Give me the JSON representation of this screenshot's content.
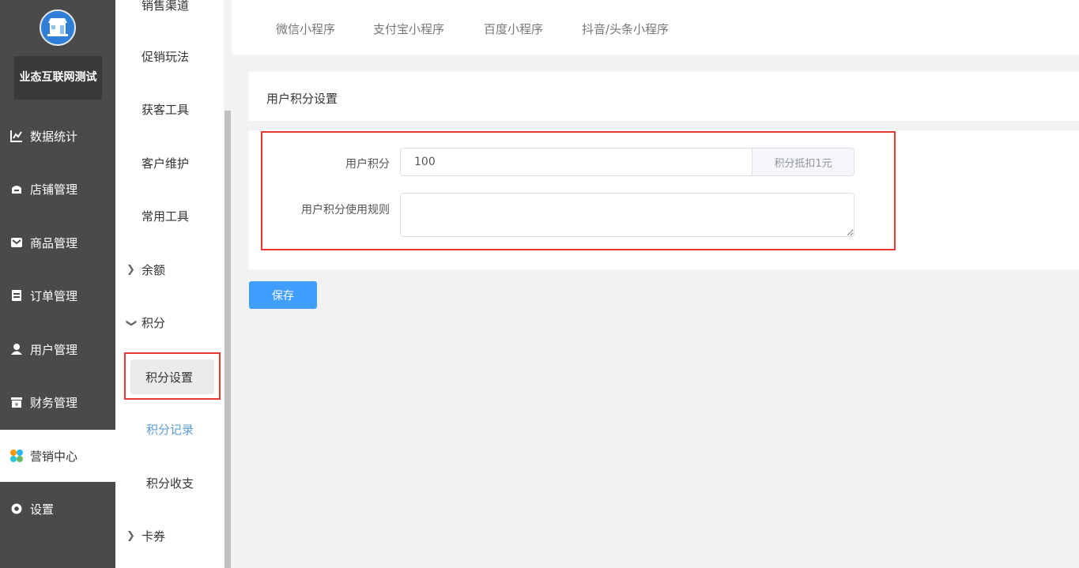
{
  "store": {
    "name": "业态互联网测试"
  },
  "nav": [
    {
      "label": "数据统计",
      "icon": "line-chart-icon"
    },
    {
      "label": "店铺管理",
      "icon": "store-icon"
    },
    {
      "label": "商品管理",
      "icon": "goods-icon"
    },
    {
      "label": "订单管理",
      "icon": "order-icon"
    },
    {
      "label": "用户管理",
      "icon": "user-icon"
    },
    {
      "label": "财务管理",
      "icon": "finance-icon"
    },
    {
      "label": "营销中心",
      "icon": "marketing-icon",
      "active": true
    },
    {
      "label": "设置",
      "icon": "settings-icon"
    }
  ],
  "submenu": {
    "items": [
      "销售渠道",
      "促销玩法",
      "获客工具",
      "客户维护",
      "常用工具"
    ],
    "groups": {
      "balance": "余额",
      "points": "积分",
      "coupons": "卡券"
    },
    "points_children": [
      "积分设置",
      "积分记录",
      "积分收支"
    ]
  },
  "tabs": [
    "微信小程序",
    "支付宝小程序",
    "百度小程序",
    "抖音/头条小程序"
  ],
  "card": {
    "title": "用户积分设置"
  },
  "form": {
    "points_label": "用户积分",
    "points_value": "100",
    "points_append": "积分抵扣1元",
    "rules_label": "用户积分使用规则",
    "rules_value": ""
  },
  "save_label": "保存",
  "colors": {
    "sidebar": "#4a4a4a",
    "primary": "#409eff",
    "highlight": "#e53935",
    "link": "#5b9bd5"
  }
}
